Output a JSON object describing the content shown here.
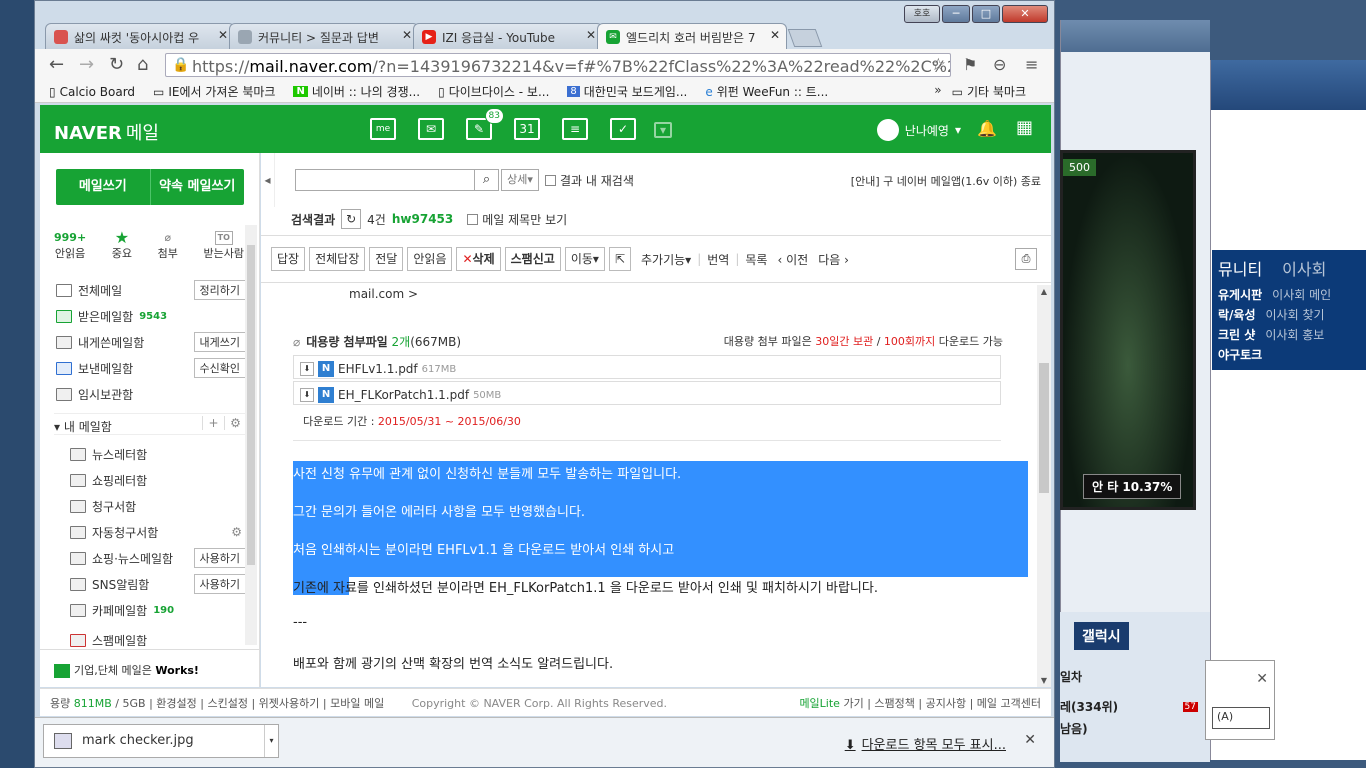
{
  "background": {
    "game_score": "500",
    "game_hud": "안 타 10.37%",
    "cafe": {
      "header_a": "뮤니티",
      "header_b": "이사회",
      "rows": [
        {
          "a": "유게시판",
          "b": "이사회 메인"
        },
        {
          "a": "락/육성",
          "b": "이사회 찾기"
        },
        {
          "a": "크린 샷",
          "b": "이사회 홍보"
        },
        {
          "a": "야구토크",
          "b": ""
        }
      ]
    },
    "galaxy": "갤럭시",
    "list_a": "일차",
    "list_b": "레(334위)",
    "list_c": "남음)",
    "badge": "57",
    "popup_select": "(A)"
  },
  "window": {
    "user_label": "호호",
    "minimize": "─",
    "maximize": "□",
    "close": "✕"
  },
  "tabs": [
    {
      "label": "삶의 싸컷 '동아시아컵 우",
      "icon_color": "#d9534f"
    },
    {
      "label": "커뮤니티 > 질문과 답변",
      "icon_color": "#9aa6b2"
    },
    {
      "label": "IZI 응급실 - YouTube",
      "icon_color": "#e62117"
    },
    {
      "label": "엘드리치 호러 버림받은 7",
      "icon_color": "#17a334"
    }
  ],
  "address": {
    "scheme": "https://",
    "host": "mail.naver.com",
    "rest": "/?n=1439196732214&v=f#%7B%22fClass%22%3A%22read%22%2C%22oParam"
  },
  "bookmarks": [
    {
      "label": "Calcio Board",
      "icon": "page"
    },
    {
      "label": "IE에서 가져온 북마크",
      "icon": "folder"
    },
    {
      "label": "네이버 :: 나의 경쟁...",
      "icon": "naver"
    },
    {
      "label": "다이브다이스 - 보...",
      "icon": "page"
    },
    {
      "label": "대한민국 보드게임...",
      "icon": "eight"
    },
    {
      "label": "위펀 WeeFun :: 트...",
      "icon": "ie"
    }
  ],
  "bookmarks_more": "»",
  "bookmarks_other": "기타 북마크",
  "naver": {
    "logo": "NAVER",
    "logo_sub": "메일",
    "icons": [
      {
        "name": "me-icon",
        "label": "me"
      },
      {
        "name": "mail-icon",
        "label": "✉"
      },
      {
        "name": "contacts-icon",
        "label": "✎"
      },
      {
        "name": "calendar-icon",
        "label": "31"
      },
      {
        "name": "memo-icon",
        "label": "≡"
      },
      {
        "name": "note-icon",
        "label": "✓"
      },
      {
        "name": "more-icon",
        "label": "▾"
      }
    ],
    "contacts_badge": "83",
    "user_name": "난나예영",
    "user_caret": "▾"
  },
  "sidebar": {
    "compose": "메일쓰기",
    "reserve": "약속 메일쓰기",
    "quick": [
      {
        "value": "999+",
        "label": "안읽음"
      },
      {
        "value": "★",
        "label": "중요"
      },
      {
        "value": "⌀",
        "label": "첨부"
      },
      {
        "value": "TO",
        "label": "받는사람"
      }
    ],
    "folders": [
      {
        "label": "전체메일",
        "count": "",
        "action": "정리하기"
      },
      {
        "label": "받은메일함",
        "count": "9543",
        "action": ""
      },
      {
        "label": "내게쓴메일함",
        "count": "",
        "action": "내게쓰기"
      },
      {
        "label": "보낸메일함",
        "count": "",
        "action": "수신확인"
      },
      {
        "label": "임시보관함",
        "count": "",
        "action": ""
      }
    ],
    "mybox": "내 메일함",
    "subfolders": [
      {
        "label": "뉴스레터함",
        "count": "",
        "action": ""
      },
      {
        "label": "쇼핑레터함",
        "count": "",
        "action": ""
      },
      {
        "label": "청구서함",
        "count": "",
        "action": ""
      },
      {
        "label": "자동청구서함",
        "count": "",
        "action": ""
      },
      {
        "label": "쇼핑·뉴스메일함",
        "count": "",
        "action": "사용하기"
      },
      {
        "label": "SNS알림함",
        "count": "",
        "action": "사용하기"
      },
      {
        "label": "카페메일함",
        "count": "190",
        "action": ""
      },
      {
        "label": "스팸메일함",
        "count": "",
        "action": ""
      }
    ],
    "works_text": "기업,단체 메일은",
    "works_brand": "Works!"
  },
  "main": {
    "search_placeholder": "",
    "search_detail": "상세",
    "search_inner": "결과 내 재검색",
    "notice": "[안내] 구 네이버 메일앱(1.6v 이하) 종료",
    "result_label": "검색결과",
    "result_count": "4건",
    "result_keyword": "hw97453",
    "subject_only": "메일 제목만 보기",
    "actions": [
      "답장",
      "전체답장",
      "전달",
      "안읽음"
    ],
    "delete": "삭제",
    "spam": "스팸신고",
    "move": "이동",
    "more_func": "추가기능",
    "translate": "번역",
    "list": "목록",
    "prev": "‹ 이전",
    "next": "다음 ›",
    "addr_tail": "mail.com >",
    "attach_title": "대용량 첨부파일",
    "attach_count": "2개",
    "attach_size": "(667MB)",
    "attach_note_a": "대용량 첨부 파일은",
    "attach_note_days": "30일간 보관",
    "attach_note_b": "/",
    "attach_note_times": "100회까지",
    "attach_note_c": "다운로드 가능",
    "files": [
      {
        "name": "EHFLv1.1.pdf",
        "size": "617MB"
      },
      {
        "name": "EH_FLKorPatch1.1.pdf",
        "size": "50MB"
      }
    ],
    "period_label": "다운로드 기간 :",
    "period_value": "2015/05/31 ~ 2015/06/30",
    "lines": [
      "사전 신청 유무에 관계 없이 신청하신 분들께 모두 발송하는 파일입니다.",
      "그간 문의가 들어온 에러타 사항을 모두 반영했습니다.",
      "처음 인쇄하시는 분이라면 EHFLv1.1 을 다운로드 받아서 인쇄 하시고",
      "기존에 자료를 인쇄하셨던 분이라면 EH_FLKorPatch1.1 을 다운로드 받아서 인쇄 및 패치하시기 바랍니다.",
      "---",
      "배포와 함께 광기의 산맥 확장의 번역 소식도 알려드립니다."
    ]
  },
  "footer": {
    "usage_label": "용량",
    "usage_value": "811MB",
    "usage_total": "/ 5GB",
    "links": [
      "환경설정",
      "스킨설정",
      "위젯사용하기",
      "모바일 메일"
    ],
    "copyright": "Copyright © NAVER Corp. All Rights Reserved.",
    "lite": "메일Lite",
    "lite_suffix": "가기",
    "right_links": [
      "스팸정책",
      "공지사항",
      "메일 고객센터"
    ]
  },
  "download": {
    "file": "mark checker.jpg",
    "show_all": "다운로드 항목 모두 표시..."
  }
}
